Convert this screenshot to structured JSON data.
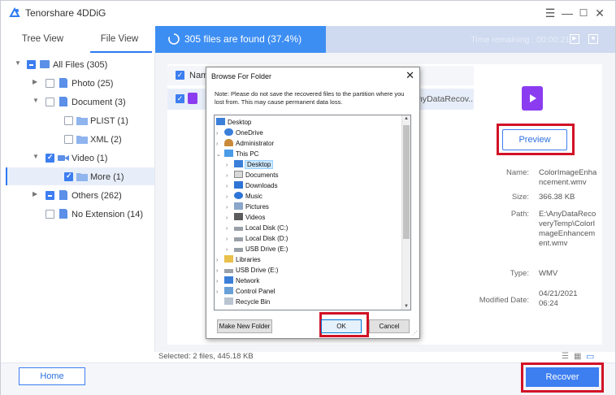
{
  "app": {
    "title": "Tenorshare 4DDiG"
  },
  "tabs": {
    "tree_view": "Tree View",
    "file_view": "File View"
  },
  "scan": {
    "status": "305 files are found (37.4%)",
    "percent": 37.4,
    "time_remaining": "Time remaining : 00:00:21"
  },
  "tree": {
    "items": [
      {
        "label": "All Files  (305)"
      },
      {
        "label": "Photo  (25)"
      },
      {
        "label": "Document  (3)"
      },
      {
        "label": "PLIST  (1)"
      },
      {
        "label": "XML  (2)"
      },
      {
        "label": "Video  (1)"
      },
      {
        "label": "More  (1)"
      },
      {
        "label": "Others  (262)"
      },
      {
        "label": "No Extension  (14)"
      }
    ]
  },
  "file_list": {
    "header_partial": "Nam",
    "row_partial": "nyDataRecov..."
  },
  "details": {
    "preview_label": "Preview",
    "name_label": "Name:",
    "name_value": "ColorImageEnhancement.wmv",
    "size_label": "Size:",
    "size_value": "366.38 KB",
    "path_label": "Path:",
    "path_value": "E:\\AnyDataRecoveryTemp\\ColorImageEnhancement.wmv",
    "type_label": "Type:",
    "type_value": "WMV",
    "modified_label": "Modified Date:",
    "modified_value": "04/21/2021 06:24"
  },
  "status": {
    "selected": "Selected: 2 files, 445.18 KB"
  },
  "buttons": {
    "home": "Home",
    "recover": "Recover"
  },
  "dialog": {
    "title": "Browse For Folder",
    "note": "Note: Please do not save the recovered files to the partition where you lost from. This may cause permanent data loss.",
    "folders": [
      {
        "label": "Desktop"
      },
      {
        "label": "OneDrive"
      },
      {
        "label": "Administrator"
      },
      {
        "label": "This PC"
      },
      {
        "label": "Desktop"
      },
      {
        "label": "Documents"
      },
      {
        "label": "Downloads"
      },
      {
        "label": "Music"
      },
      {
        "label": "Pictures"
      },
      {
        "label": "Videos"
      },
      {
        "label": "Local Disk (C:)"
      },
      {
        "label": "Local Disk (D:)"
      },
      {
        "label": "USB Drive (E:)"
      },
      {
        "label": "Libraries"
      },
      {
        "label": "USB Drive (E:)"
      },
      {
        "label": "Network"
      },
      {
        "label": "Control Panel"
      },
      {
        "label": "Recycle Bin"
      }
    ],
    "new_folder": "Make New Folder",
    "ok": "OK",
    "cancel": "Cancel"
  },
  "colors": {
    "accent": "#3d7ef0",
    "highlight_box": "#d11226",
    "file_icon": "#8b3cf0"
  }
}
